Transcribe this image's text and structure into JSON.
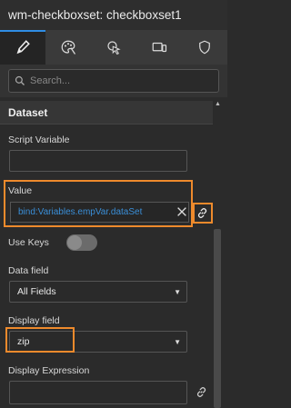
{
  "window": {
    "title": "wm-checkboxset: checkboxset1"
  },
  "tabs": [
    {
      "icon": "pencil-icon",
      "active": true
    },
    {
      "icon": "palette-icon",
      "active": false
    },
    {
      "icon": "pointer-click-icon",
      "active": false
    },
    {
      "icon": "devices-icon",
      "active": false
    },
    {
      "icon": "shield-icon",
      "active": false
    }
  ],
  "search": {
    "placeholder": "Search..."
  },
  "section": {
    "title": "Dataset"
  },
  "fields": {
    "script_variable": {
      "label": "Script Variable",
      "value": ""
    },
    "value": {
      "label": "Value",
      "value": "bind:Variables.empVar.dataSet"
    },
    "use_keys": {
      "label": "Use Keys",
      "checked": false
    },
    "data_field": {
      "label": "Data field",
      "value": "All Fields"
    },
    "display_field": {
      "label": "Display field",
      "value": "zip"
    },
    "display_expression": {
      "label": "Display Expression",
      "value": ""
    }
  },
  "colors": {
    "accent": "#2f8de4",
    "highlight": "#ee8a2c",
    "bind_text": "#3a8fd8"
  }
}
